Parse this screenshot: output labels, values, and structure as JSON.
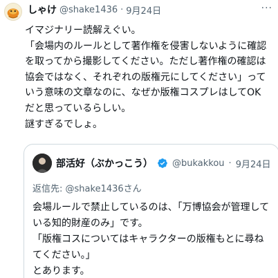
{
  "tweet": {
    "author_name": "しゃけ",
    "author_handle": "@shake1436",
    "separator": "·",
    "date": "9月24日",
    "more_icon": "more-dots-icon",
    "body": "イマジナリー読解えぐい。\n「会場内のルールとして著作権を侵害しないように確認を取ってから撮影してください。ただし著作権の確認は協会ではなく、それぞれの版権元にしてください」っていう意味の文章なのに、なぜか版権コスプレはしてOKだと思っているらしい。\n謎すぎるでしょ。"
  },
  "quote": {
    "author_name": "部活好（ぶかっこう）",
    "author_handle": "@bukakkou",
    "separator": "·",
    "date": "9月24日",
    "verified": true,
    "reply_label": "返信先:",
    "reply_handle": "@shake1436",
    "reply_suffix": "さん",
    "body": "会場ルールで禁止しているのは、「万博協会が管理している知的財産のみ」です。\n「版権コスについてはキャラクターの版権もとに尋ねてください。」\nとあります。"
  },
  "colors": {
    "text": "#0f1419",
    "secondary": "#536471",
    "verified": "#1d9bf0",
    "border": "#cfd9de"
  }
}
